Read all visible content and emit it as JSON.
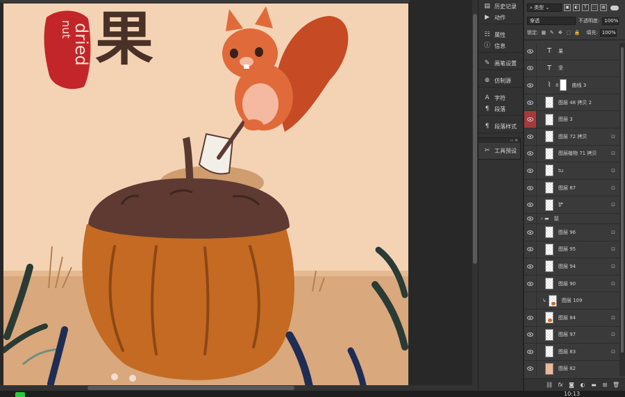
{
  "artwork": {
    "title_char": "果",
    "stamp_text_1": "dried",
    "stamp_text_2": "nut"
  },
  "panel_strip": {
    "groups": [
      [
        {
          "icon": "history-icon",
          "glyph": "▤",
          "label": "历史记录"
        },
        {
          "icon": "play-icon",
          "glyph": "▶",
          "label": "动作"
        }
      ],
      [
        {
          "icon": "properties-icon",
          "glyph": "☷",
          "label": "属性"
        },
        {
          "icon": "info-icon",
          "glyph": "ⓘ",
          "label": "信息"
        }
      ],
      [
        {
          "icon": "brush-settings-icon",
          "glyph": "✎",
          "label": "画笔设置"
        }
      ],
      [
        {
          "icon": "clone-source-icon",
          "glyph": "⊕",
          "label": "仿制源"
        }
      ],
      [
        {
          "icon": "character-icon",
          "glyph": "A",
          "label": "字符"
        },
        {
          "icon": "paragraph-icon",
          "glyph": "¶",
          "label": "段落"
        }
      ],
      [
        {
          "icon": "paragraph-styles-icon",
          "glyph": "¶",
          "label": "段落样式"
        }
      ]
    ],
    "tool_preset": {
      "glyph": "✂",
      "label": "工具预设"
    }
  },
  "layers_panel": {
    "kind_filter": "类型",
    "blend_mode": "穿透",
    "opacity_label": "不透明度:",
    "opacity_value": "100%",
    "lock_label": "锁定:",
    "fill_label": "填充:",
    "fill_value": "100%",
    "layers": [
      {
        "name": "果",
        "type": "text",
        "visible": true,
        "locked": false
      },
      {
        "name": "坚",
        "type": "text",
        "visible": true,
        "locked": false
      },
      {
        "name": "曲线 3",
        "type": "adjustment",
        "visible": true,
        "locked": false
      },
      {
        "name": "图层 48 拷贝 2",
        "type": "pixel",
        "visible": true,
        "locked": false
      },
      {
        "name": "图层 3",
        "type": "pixel",
        "visible": true,
        "locked": false,
        "highlight": true
      },
      {
        "name": "图层 72 拷贝",
        "type": "pixel",
        "visible": true,
        "locked": true
      },
      {
        "name": "图层植物 71 拷贝",
        "type": "pixel",
        "visible": true,
        "locked": true
      },
      {
        "name": "tu",
        "type": "pixel",
        "visible": true,
        "locked": true
      },
      {
        "name": "图层 87",
        "type": "pixel",
        "visible": true,
        "locked": true
      },
      {
        "name": "铲",
        "type": "pixel",
        "visible": true,
        "locked": true
      },
      {
        "name": "鼠",
        "type": "group",
        "visible": true,
        "locked": false
      },
      {
        "name": "图层 96",
        "type": "pixel",
        "visible": true,
        "locked": true
      },
      {
        "name": "图层 95",
        "type": "pixel",
        "visible": true,
        "locked": true
      },
      {
        "name": "图层 94",
        "type": "pixel",
        "visible": true,
        "locked": true
      },
      {
        "name": "图层 90",
        "type": "pixel",
        "visible": true,
        "locked": true
      },
      {
        "name": "图层 109",
        "type": "clipped",
        "visible": false,
        "locked": false
      },
      {
        "name": "图层 84",
        "type": "orange",
        "visible": true,
        "locked": true
      },
      {
        "name": "图层 97",
        "type": "pixel",
        "visible": true,
        "locked": true
      },
      {
        "name": "图层 83",
        "type": "pixel",
        "visible": true,
        "locked": true
      },
      {
        "name": "图层 82",
        "type": "solid",
        "visible": true,
        "locked": false
      }
    ],
    "footer_icons": [
      "link-icon",
      "fx-icon",
      "mask-icon",
      "adjustment-icon",
      "folder-icon",
      "new-layer-icon",
      "trash-icon"
    ]
  },
  "status": {
    "clock": "10:13"
  },
  "colors": {
    "canvas_bg": "#f4d3b5",
    "stamp_red": "#c2262b",
    "acorn_cap": "#5e3a33",
    "acorn_body": "#c46a22",
    "squirrel": "#e06a3a"
  }
}
